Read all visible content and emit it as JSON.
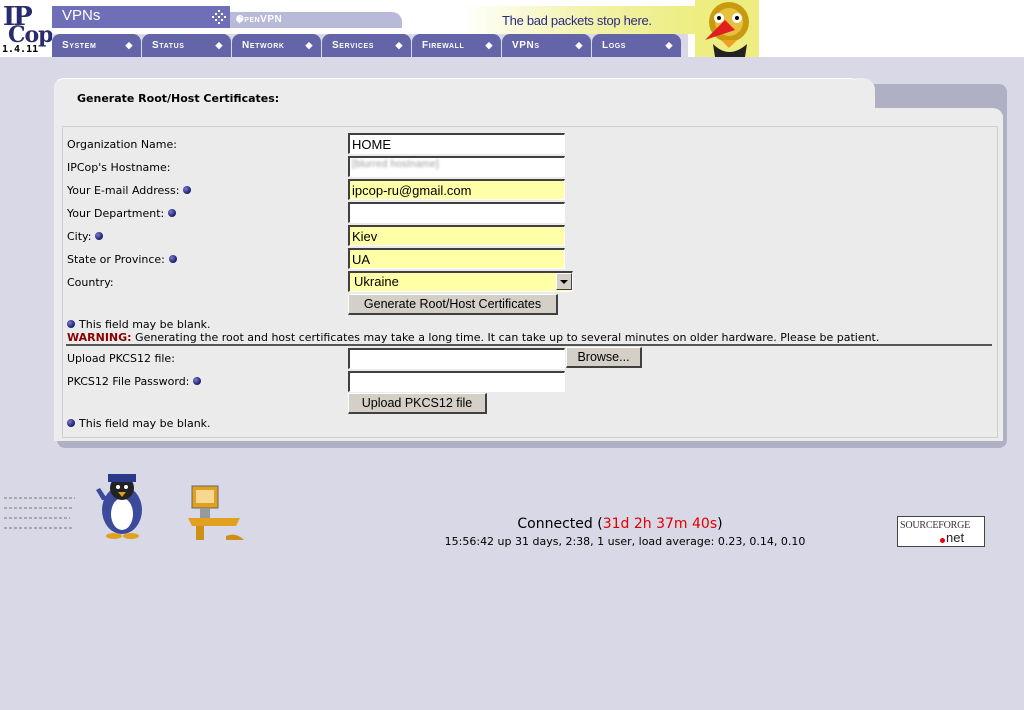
{
  "header": {
    "logo_ip": "IP",
    "logo_cop": "Cop",
    "version": "1.4.11",
    "section_title": "VPNs",
    "subtab_label": "OpenVPN",
    "tagline": "The bad packets stop here."
  },
  "menu": [
    {
      "label": "System"
    },
    {
      "label": "Status"
    },
    {
      "label": "Network"
    },
    {
      "label": "Services"
    },
    {
      "label": "Firewall"
    },
    {
      "label": "VPNs"
    },
    {
      "label": "Logs"
    }
  ],
  "panel": {
    "title": "Generate Root/Host Certificates:"
  },
  "form": {
    "org_label": "Organization Name:",
    "org_value": "HOME",
    "hostname_label": "IPCop's Hostname:",
    "hostname_value": "[blurred hostname]",
    "email_label": "Your E-mail Address:",
    "email_value": "ipcop-ru@gmail.com",
    "dept_label": "Your Department:",
    "dept_value": "",
    "city_label": "City:",
    "city_value": "Kiev",
    "state_label": "State or Province:",
    "state_value": "UA",
    "country_label": "Country:",
    "country_value": "Ukraine",
    "generate_button": "Generate Root/Host Certificates",
    "blank_note": "This field may be blank.",
    "warning_prefix": "WARNING:",
    "warning_text": " Generating the root and host certificates may take a long time. It can take up to several minutes on older hardware. Please be patient.",
    "upload_label": "Upload PKCS12 file:",
    "upload_value": "",
    "browse_button": "Browse...",
    "pkcs_password_label": "PKCS12 File Password:",
    "pkcs_password_value": "",
    "upload_button": "Upload PKCS12 file",
    "blank_note2": "This field may be blank."
  },
  "footer": {
    "connected_label": "Connected (",
    "connected_time": "31d 2h 37m 40s",
    "connected_close": ")",
    "uptime": "15:56:42 up 31 days,  2:38,  1 user,  load average: 0.23, 0.14, 0.10",
    "sf_line1": "SOURCEFORGE",
    "sf_line2": "net"
  },
  "colors": {
    "menu_bg": "#6464a8",
    "required_field_bg": "#ffffa8",
    "warning": "#8b0000",
    "connected_time": "#e00000"
  }
}
